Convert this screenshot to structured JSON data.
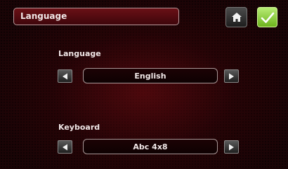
{
  "header": {
    "title": "Language"
  },
  "icons": {
    "home": "home-icon",
    "confirm": "checkmark-icon",
    "prev": "arrow-left-icon",
    "next": "arrow-right-icon"
  },
  "colors": {
    "confirm_button": "#8fd24a",
    "background": "#3a070b"
  },
  "language_setting": {
    "label": "Language",
    "value": "English"
  },
  "keyboard_setting": {
    "label": "Keyboard",
    "value": "Abc 4x8"
  }
}
